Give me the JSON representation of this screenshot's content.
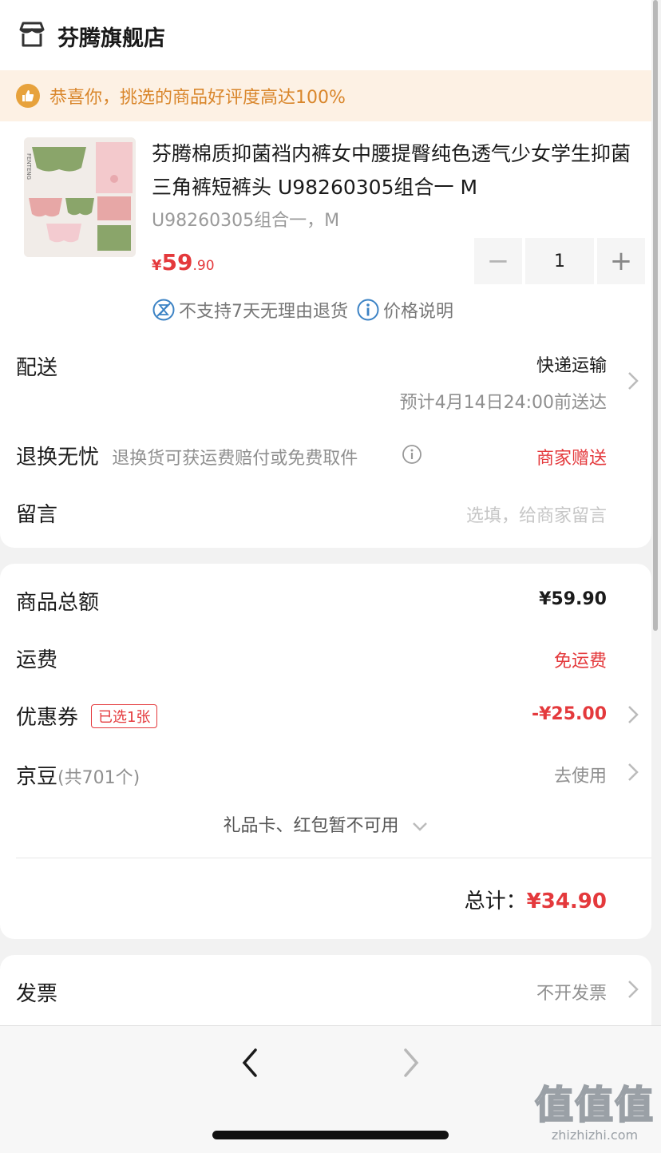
{
  "store": {
    "name": "芬腾旗舰店"
  },
  "banner": {
    "text": "恭喜你，挑选的商品好评度高达100%"
  },
  "product": {
    "title": "芬腾棉质抑菌裆内裤女中腰提臀纯色透气少女学生抑菌三角裤短裤头 U98260305组合一 M",
    "spec": "U98260305组合一，M",
    "price_symbol": "¥",
    "price_int": "59",
    "price_dec": ".90",
    "quantity": "1",
    "minus": "−",
    "plus": "+",
    "tag_no_return": "不支持7天无理由退货",
    "tag_price_info": "价格说明",
    "thumb_brand": "FENTENG"
  },
  "delivery": {
    "label": "配送",
    "method": "快递运输",
    "eta": "预计4月14日24:00前送达"
  },
  "returns": {
    "label": "退换无忧",
    "desc": "退换货可获运费赔付或免费取件",
    "value": "商家赠送"
  },
  "message": {
    "label": "留言",
    "placeholder": "选填，给商家留言"
  },
  "summary": {
    "goods_total_label": "商品总额",
    "goods_total_value": "¥59.90",
    "shipping_label": "运费",
    "shipping_value": "免运费",
    "coupon_label": "优惠券",
    "coupon_tag": "已选1张",
    "coupon_value": "-¥25.00",
    "beans_label": "京豆",
    "beans_count": "(共701个)",
    "beans_action": "去使用",
    "giftcard_text": "礼品卡、红包暂不可用",
    "total_label": "总计：",
    "total_value": "¥34.90"
  },
  "invoice": {
    "label": "发票",
    "value": "不开发票"
  },
  "watermark": {
    "big": "值值值",
    "small": "zhizhizhi.com"
  },
  "colors": {
    "accent_red": "#e4393c",
    "banner_bg": "#fdf1e4",
    "banner_text": "#d9862b"
  }
}
